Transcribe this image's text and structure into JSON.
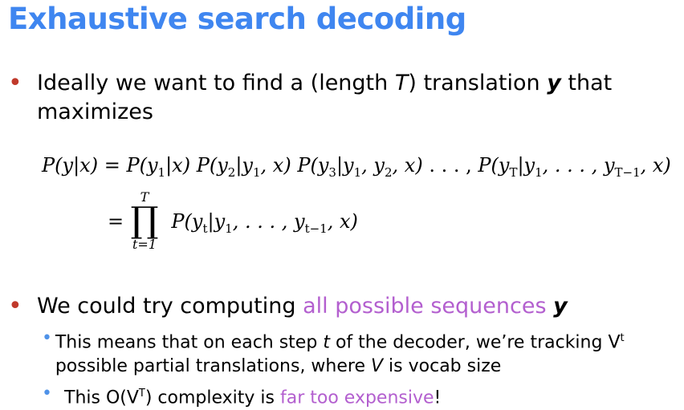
{
  "slide": {
    "title": "Exhaustive search decoding",
    "bullet1": {
      "text_a": "Ideally we want to find a (length ",
      "var_T": "T",
      "text_b": ") translation ",
      "var_y": "y",
      "text_c": " that maximizes"
    },
    "equation": {
      "line1_lhs": "P(y|x)",
      "eq_sign": "=",
      "term1": "P(y",
      "term1_rest": "|x)",
      "term2": "P(y",
      "term2_rest": "|y",
      "term2_end": ", x)",
      "term3": "P(y",
      "term3_rest": "|y",
      "term3_mid": ", y",
      "term3_end": ", x)",
      "dots": " . . . ,",
      "term4": "P(y",
      "term4_sub": "T",
      "term4_rest": "|y",
      "term4_end": ", . . . , y",
      "term4_sub2": "T−1",
      "term4_close": ", x)",
      "line2_eq": "=",
      "prod_upper": "T",
      "prod_symbol": "∏",
      "prod_lower": "t=1",
      "prod_term": "P(y",
      "prod_term_sub": "t",
      "prod_term_rest": "|y",
      "prod_term_end": ", . . . , y",
      "prod_term_sub2": "t−1",
      "prod_term_close": ", x)"
    },
    "bullet2": {
      "text_a": "We could try computing ",
      "highlight": "all possible sequences",
      "var_y": "y"
    },
    "sub1": {
      "text_a": "This means that on each step ",
      "var_t": "t",
      "text_b": " of the decoder, we’re tracking V",
      "sup_t": "t",
      "text_c": " possible partial translations, where ",
      "var_V": "V",
      "text_d": " is vocab size"
    },
    "sub2": {
      "text_a": "This O(V",
      "sup_T": "T",
      "text_b": ") complexity is ",
      "highlight": "far too expensive",
      "text_c": "!"
    }
  },
  "colors": {
    "title": "#3f86f0",
    "bullet": "#c0392b",
    "sub_bullet": "#4f92e8",
    "highlight": "#b35fcf"
  }
}
